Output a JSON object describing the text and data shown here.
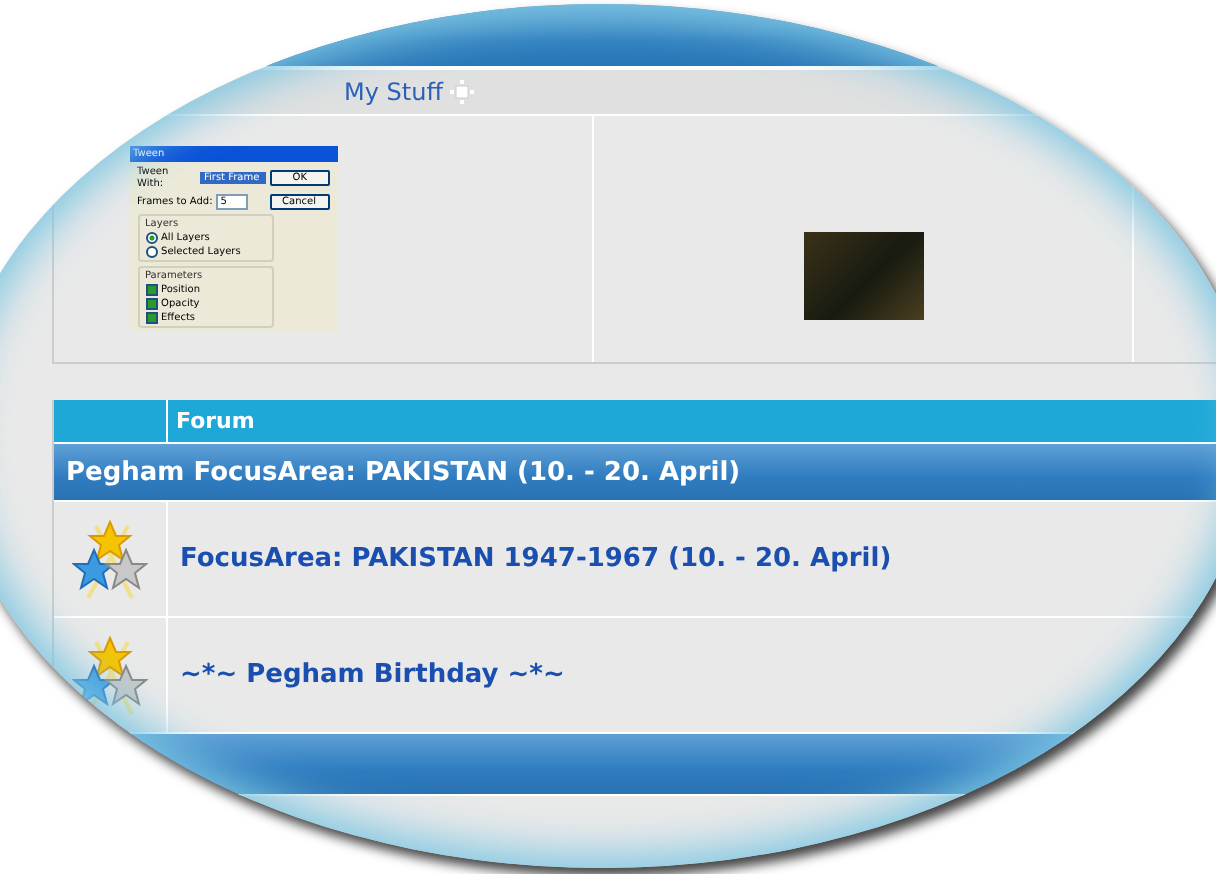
{
  "nav": {
    "link": "My Stuff"
  },
  "thumbnails": [
    {
      "kind": "dialog",
      "title": "Tween",
      "tween_with_label": "Tween With:",
      "tween_with_value": "First Frame",
      "ok": "OK",
      "frames_label": "Frames to Add:",
      "frames_value": "5",
      "cancel": "Cancel",
      "layers": {
        "title": "Layers",
        "options": [
          {
            "label": "All Layers",
            "selected": true
          },
          {
            "label": "Selected Layers",
            "selected": false
          }
        ]
      },
      "parameters": {
        "title": "Parameters",
        "options": [
          {
            "label": "Position",
            "checked": true
          },
          {
            "label": "Opacity",
            "checked": true
          },
          {
            "label": "Effects",
            "checked": true
          }
        ]
      }
    },
    {
      "kind": "photo"
    }
  ],
  "table": {
    "columns": [
      "Forum"
    ],
    "category": "Pegham FocusArea: PAKISTAN (10. - 20. April)",
    "rows": [
      {
        "title": "FocusArea: PAKISTAN 1947-1967 (10. - 20. April)"
      },
      {
        "title": "~*~ Pegham Birthday ~*~"
      }
    ]
  }
}
